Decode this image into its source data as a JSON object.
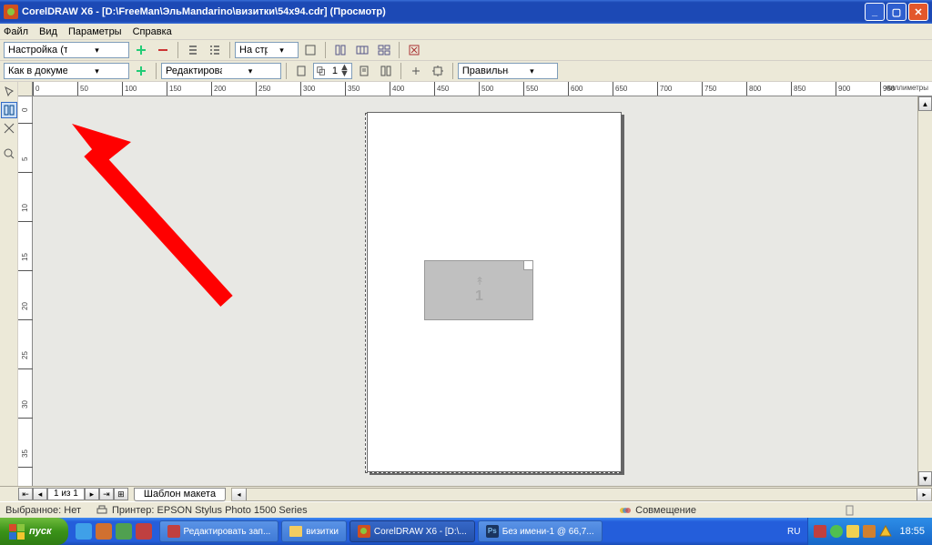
{
  "title": "CorelDRAW X6 - [D:\\FreeMan\\ЭльMandarino\\визитки\\54x94.cdr] (Просмотр)",
  "menu": {
    "file": "Файл",
    "view": "Вид",
    "options": "Параметры",
    "help": "Справка"
  },
  "toolbar1": {
    "preset": "Настройка (текущие парамет...",
    "view_dd": "На страницу"
  },
  "toolbar2": {
    "doc_fit": "Как в документе (Вся страница)",
    "edit_main": "Редактировать основные пар",
    "spinner": "1",
    "brochure": "Правильная брошюровк"
  },
  "ruler_top": [
    "0",
    "50",
    "100",
    "150",
    "200",
    "250",
    "300",
    "350",
    "400",
    "450",
    "500",
    "550",
    "600",
    "650",
    "700",
    "750",
    "800",
    "850",
    "900",
    "950"
  ],
  "ruler_units": "миллиметры",
  "ruler_left": [
    "0",
    "5",
    "10",
    "15",
    "20",
    "25",
    "30",
    "35"
  ],
  "thumb_num": "1",
  "pagenav": {
    "pos": "1 из 1",
    "tab": "Шаблон макета"
  },
  "status": {
    "sel": "Выбранное: Нет",
    "printer": "Принтер: EPSON Stylus Photo 1500 Series",
    "spusk": "Совмещение"
  },
  "taskbar": {
    "start": "пуск",
    "t1": "Редактировать зап...",
    "t2": "визитки",
    "t3": "CorelDRAW X6 - [D:\\...",
    "t4": "Без имени-1 @ 66,7...",
    "lang": "RU",
    "clock": "18:55"
  }
}
